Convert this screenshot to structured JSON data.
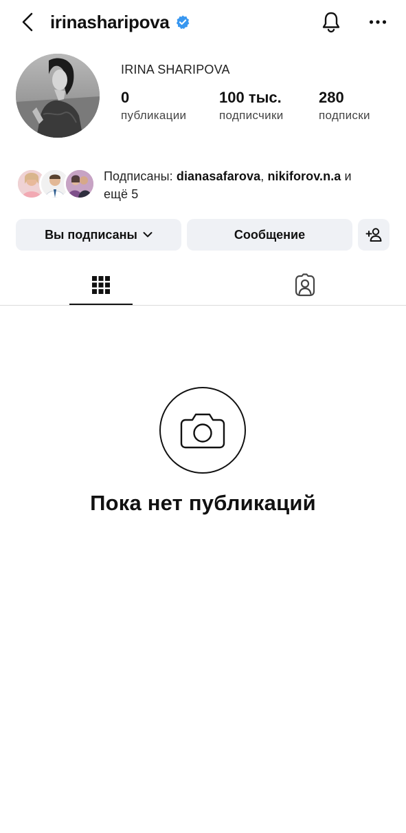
{
  "header": {
    "username": "irinasharipova",
    "verified": true,
    "icons": {
      "back": "chevron-left-icon",
      "bell": "bell-icon",
      "more": "more-horizontal-icon",
      "verified": "verified-badge-icon"
    },
    "verified_color": "#3897f0"
  },
  "profile": {
    "display_name": "IRINA SHARIPOVA",
    "stats": [
      {
        "value": "0",
        "label": "публикации"
      },
      {
        "value": "100 тыс.",
        "label": "подписчики"
      },
      {
        "value": "280",
        "label": "подписки"
      }
    ]
  },
  "followed_by": {
    "prefix": "Подписаны: ",
    "users": [
      "dianasafarova",
      "nikiforov.n.a"
    ],
    "separator": ", ",
    "suffix": " и",
    "more": "ещё 5"
  },
  "actions": {
    "following_label": "Вы подписаны",
    "message_label": "Сообщение",
    "add_icon": "add-person-icon",
    "button_bg": "#eff1f5"
  },
  "tabs": [
    {
      "name": "posts",
      "icon": "grid-icon",
      "active": true
    },
    {
      "name": "tagged",
      "icon": "tagged-person-icon",
      "active": false
    }
  ],
  "empty_state": {
    "icon": "camera-icon",
    "title": "Пока нет публикаций"
  }
}
